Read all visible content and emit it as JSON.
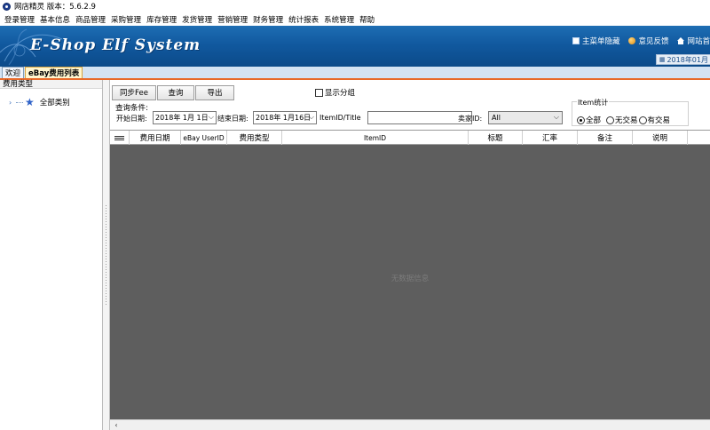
{
  "window": {
    "title": "网店精灵  版本：5.6.2.9"
  },
  "menu": [
    "登录管理",
    "基本信息",
    "商品管理",
    "采购管理",
    "库存管理",
    "发货管理",
    "营销管理",
    "财务管理",
    "统计报表",
    "系统管理",
    "帮助"
  ],
  "banner": {
    "logo": "E-Shop Elf System",
    "links": [
      {
        "icon": "menu-icon",
        "label": "主菜单隐藏"
      },
      {
        "icon": "feedback-icon",
        "label": "意见反馈"
      },
      {
        "icon": "home-icon",
        "label": "网站首"
      }
    ],
    "date": "2018年01月",
    "colors": {
      "banner": "#11599f",
      "tab_underline": "#e86a2a"
    }
  },
  "tabs": [
    {
      "label": "欢迎",
      "active": false
    },
    {
      "label": "eBay费用列表",
      "active": true
    }
  ],
  "sidebar": {
    "header": "费用类型",
    "tree": {
      "label": "全部类别",
      "icon": "star-icon"
    }
  },
  "toolbar": {
    "sync_label": "同步Fee",
    "query_label": "查询",
    "export_label": "导出",
    "show_group_label": "显示分组",
    "show_group_checked": false
  },
  "query": {
    "section_label": "查询条件:",
    "start_label": "开始日期:",
    "start_value": "2018年  1月  1日",
    "end_label": "结束日期:",
    "end_value": "2018年  1月16日",
    "item_label": "ItemID/Title",
    "item_value": "",
    "seller_label": "卖家ID:",
    "seller_value": "All",
    "stats_legend": "Item统计",
    "radios": [
      {
        "label": "全部",
        "checked": true
      },
      {
        "label": "无交易",
        "checked": false
      },
      {
        "label": "有交易",
        "checked": false
      }
    ]
  },
  "grid": {
    "columns": [
      "费用日期",
      "eBay UserID",
      "费用类型",
      "ItemID",
      "标题",
      "汇率",
      "备注",
      "说明"
    ],
    "empty_text": "无数据信息"
  }
}
